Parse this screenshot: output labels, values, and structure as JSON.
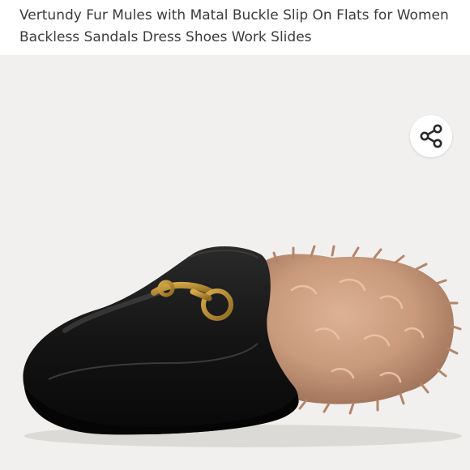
{
  "listing": {
    "title": "Vertundy Fur Mules with Matal Buckle Slip On Flats for Women Backless Sandals Dress Shoes Work Slides"
  },
  "icons": {
    "share": "share-icon"
  },
  "colors": {
    "photo_background": "#f1f0ee",
    "shoe_leather": "#141414",
    "fur": "#c99a7c",
    "buckle": "#b88a2e",
    "title_text": "#3b3b3b"
  }
}
